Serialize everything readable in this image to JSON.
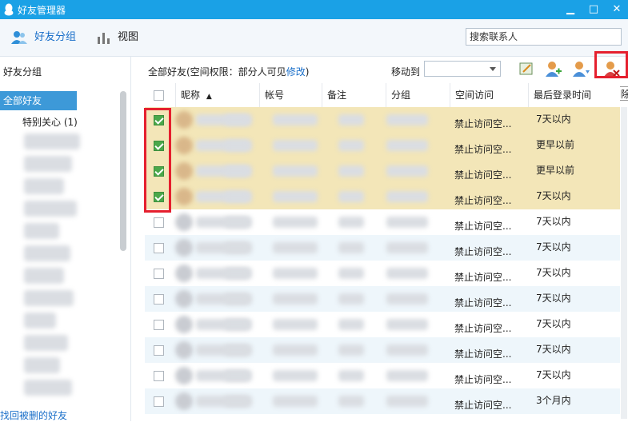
{
  "window": {
    "title": "好友管理器",
    "minimize": "▁",
    "maximize": "□",
    "close": "✕"
  },
  "toolbar": {
    "groups_label": "好友分组",
    "view_label": "视图",
    "search_placeholder": "搜索联系人"
  },
  "sidebar": {
    "header": "好友分组",
    "active_group": "全部好友",
    "special_group": "特别关心 (1)",
    "find_deleted_link": "找回被删的好友"
  },
  "main": {
    "info_prefix": "全部好友(空间权限：部分人可见",
    "info_link": "修改",
    "info_suffix": ")",
    "move_to_label": "移动到",
    "tooltip": "删除",
    "columns": [
      "昵称",
      "帐号",
      "备注",
      "分组",
      "空间访问",
      "最后登录时间"
    ],
    "rows": [
      {
        "checked": true,
        "access": "禁止访问空...",
        "last_login": "7天以内"
      },
      {
        "checked": true,
        "access": "禁止访问空...",
        "last_login": "更早以前"
      },
      {
        "checked": true,
        "access": "禁止访问空...",
        "last_login": "更早以前"
      },
      {
        "checked": true,
        "access": "禁止访问空...",
        "last_login": "7天以内"
      },
      {
        "checked": false,
        "access": "禁止访问空...",
        "last_login": "7天以内"
      },
      {
        "checked": false,
        "access": "禁止访问空...",
        "last_login": "7天以内"
      },
      {
        "checked": false,
        "access": "禁止访问空...",
        "last_login": "7天以内"
      },
      {
        "checked": false,
        "access": "禁止访问空...",
        "last_login": "7天以内"
      },
      {
        "checked": false,
        "access": "禁止访问空...",
        "last_login": "7天以内"
      },
      {
        "checked": false,
        "access": "禁止访问空...",
        "last_login": "7天以内"
      },
      {
        "checked": false,
        "access": "禁止访问空...",
        "last_login": "7天以内"
      },
      {
        "checked": false,
        "access": "禁止访问空...",
        "last_login": "3个月内"
      }
    ]
  },
  "colors": {
    "accent": "#1aa1e6",
    "selected_row": "#f3e6b8",
    "alt_row": "#eef6fb",
    "highlight": "#e5202e"
  }
}
